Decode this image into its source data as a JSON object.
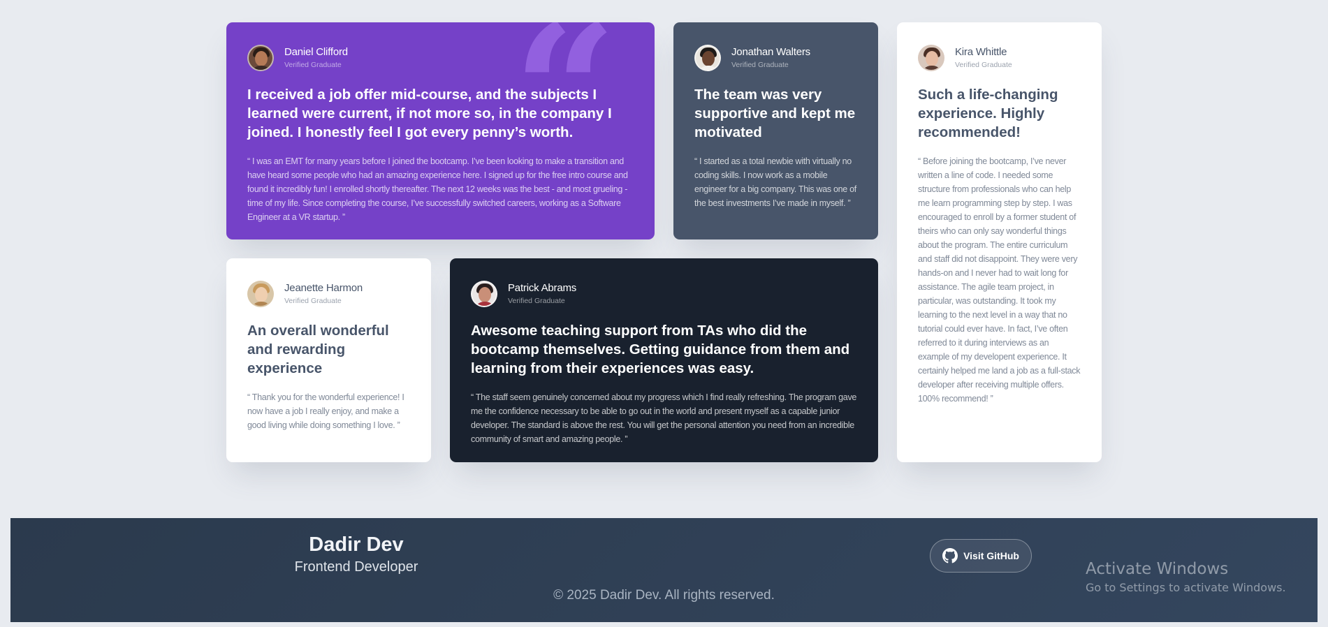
{
  "testimonials": [
    {
      "name": "Daniel Clifford",
      "role": "Verified Graduate",
      "headline": "I received a job offer mid-course, and the subjects I learned were current, if not more so, in the company I joined. I honestly feel I got every penny’s worth.",
      "body": "“ I was an EMT for many years before I joined the bootcamp. I’ve been looking to make a transition and have heard some people who had an amazing experience here. I signed up for the free intro course and found it incredibly fun! I enrolled shortly thereafter. The next 12 weeks was the best - and most grueling - time of my life. Since completing the course, I’ve successfully switched careers, working as a Software Engineer at a VR startup. ”",
      "avatar_icon": "daniel-avatar-photo",
      "color": "#7541c8"
    },
    {
      "name": "Jonathan Walters",
      "role": "Verified Graduate",
      "headline": "The team was very supportive and kept me motivated",
      "body": "“ I started as a total newbie with virtually no coding skills. I now work as a mobile engineer for a big company. This was one of the best investments I’ve made in myself. ”",
      "avatar_icon": "jonathan-avatar-photo",
      "color": "#48556a"
    },
    {
      "name": "Kira Whittle",
      "role": "Verified Graduate",
      "headline": "Such a life-changing experience. Highly recommended!",
      "body": "“ Before joining the bootcamp, I’ve never written a line of code. I needed some structure from professionals who can help me learn programming step by step. I was encouraged to enroll by a former student of theirs who can only say wonderful things about the program. The entire curriculum and staff did not disappoint. They were very hands-on and I never had to wait long for assistance. The agile team project, in particular, was outstanding. It took my learning to the next level in a way that no tutorial could ever have. In fact, I’ve often referred to it during interviews as an example of my developent experience. It certainly helped me land a job as a full-stack developer after receiving multiple offers. 100% recommend! ”",
      "avatar_icon": "kira-avatar-photo",
      "color": "#ffffff"
    },
    {
      "name": "Jeanette Harmon",
      "role": "Verified Graduate",
      "headline": "An overall wonderful and rewarding experience",
      "body": "“ Thank you for the wonderful experience! I now have a job I really enjoy, and make a good living while doing something I love. ”",
      "avatar_icon": "jeanette-avatar-photo",
      "color": "#ffffff"
    },
    {
      "name": "Patrick Abrams",
      "role": "Verified Graduate",
      "headline": "Awesome teaching support from TAs who did the bootcamp themselves. Getting guidance from them and learning from their experiences was easy.",
      "body": "“ The staff seem genuinely concerned about my progress which I find really refreshing. The program gave me the confidence necessary to be able to go out in the world and present myself as a capable junior developer. The standard is above the rest. You will get the personal attention you need from an incredible community of smart and amazing people. ”",
      "avatar_icon": "patrick-avatar-photo",
      "color": "#19212e"
    }
  ],
  "footer": {
    "brand_name": "Dadir Dev",
    "brand_role": "Frontend Developer",
    "github_label": "Visit GitHub",
    "github_icon": "github-icon",
    "copyright": "© 2025 Dadir Dev. All rights reserved."
  },
  "watermark": {
    "line1": "Activate Windows",
    "line2": "Go to Settings to activate Windows."
  },
  "colors": {
    "background": "#e8ebf0",
    "purple": "#7541c8",
    "slate": "#48556a",
    "dark": "#19212e",
    "footer": "#2b3a4d"
  }
}
